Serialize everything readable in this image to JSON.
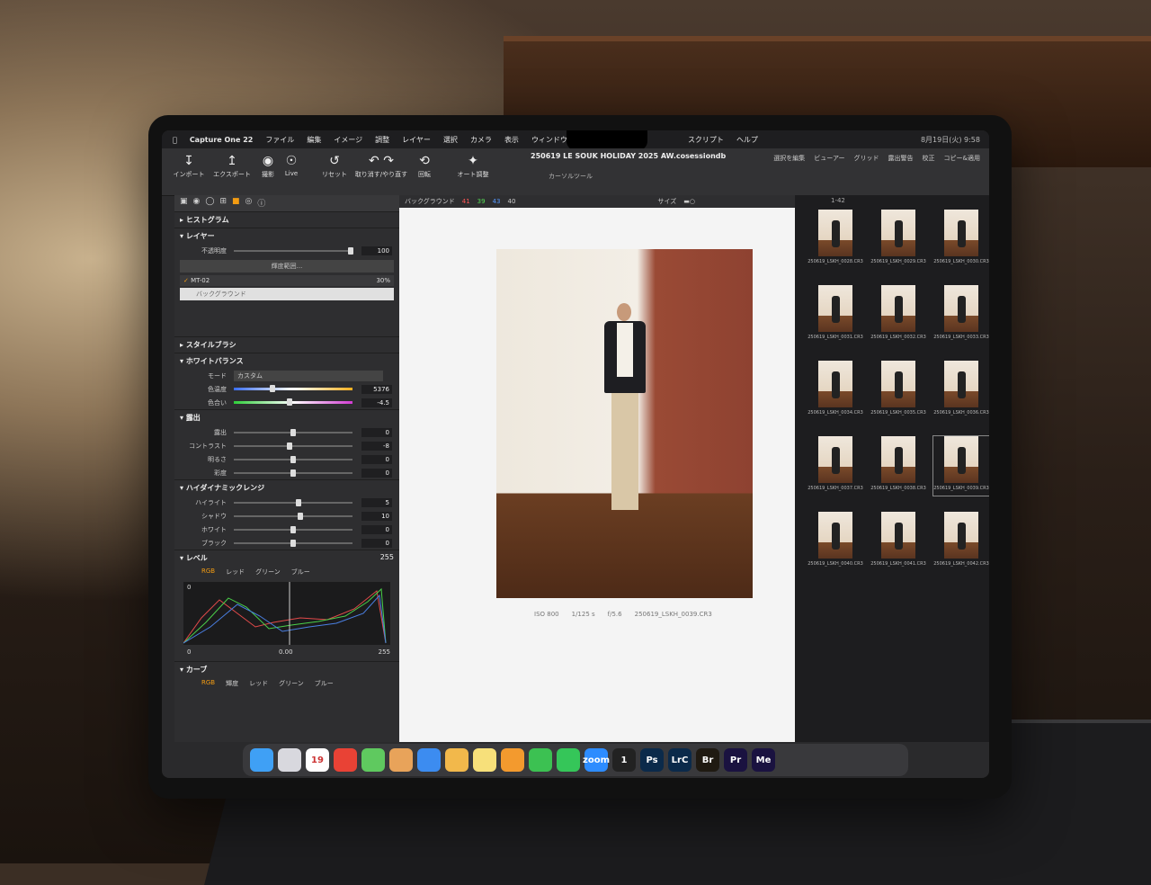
{
  "menubar": {
    "app_name": "Capture One 22",
    "items": [
      "ファイル",
      "編集",
      "イメージ",
      "調整",
      "レイヤー",
      "選択",
      "カメラ",
      "表示",
      "ウィンドウ",
      "スクリプト",
      "ヘルプ"
    ],
    "clock": "8月19日(火) 9:58"
  },
  "toolbar": {
    "import": "インポート",
    "export": "エクスポート",
    "capture": "撮影",
    "live": "Live",
    "reset": "リセット",
    "undo_redo": "取り消す/やり直す",
    "rotate": "回転",
    "auto_adjust": "オート調整",
    "cursor_tools": "カーソルツール",
    "doc_title": "250619 LE SOUK HOLIDAY 2025 AW.cosessiondb",
    "right_tools": [
      "選択を編集",
      "ビューアー",
      "グリッド",
      "露出警告",
      "校正",
      "コピー&適用"
    ]
  },
  "left_panel": {
    "histogram": "ヒストグラム",
    "layers": "レイヤー",
    "opacity_label": "不透明度",
    "opacity_value": "100",
    "luma_range": "輝度範囲...",
    "layer_name": "MT-02",
    "layer_opacity": "30%",
    "background_layer": "バックグラウンド",
    "style_brush": "スタイルブラシ",
    "white_balance": "ホワイトバランス",
    "mode_label": "モード",
    "mode_value": "カスタム",
    "temp_label": "色温度",
    "temp_value": "5376",
    "tint_label": "色合い",
    "tint_value": "-4.5",
    "exposure": "露出",
    "exposure_rows": [
      {
        "label": "露出",
        "value": "0"
      },
      {
        "label": "コントラスト",
        "value": "-8"
      },
      {
        "label": "明るさ",
        "value": "0"
      },
      {
        "label": "彩度",
        "value": "0"
      }
    ],
    "hdr": "ハイダイナミックレンジ",
    "hdr_rows": [
      {
        "label": "ハイライト",
        "value": "5"
      },
      {
        "label": "シャドウ",
        "value": "10"
      },
      {
        "label": "ホワイト",
        "value": "0"
      },
      {
        "label": "ブラック",
        "value": "0"
      }
    ],
    "levels": "レベル",
    "levels_tabs": [
      "RGB",
      "レッド",
      "グリーン",
      "ブルー"
    ],
    "levels_top": "255",
    "levels_left": "0",
    "levels_mid": "0.00",
    "levels_bottom_left": "0",
    "levels_bottom_right": "255",
    "curve": "カーブ",
    "curve_tabs": [
      "RGB",
      "輝度",
      "レッド",
      "グリーン",
      "ブルー"
    ]
  },
  "viewer": {
    "variant": "バックグラウンド",
    "rgb": {
      "r": "41",
      "g": "39",
      "b": "43",
      "a": "40"
    },
    "size_label": "サイズ",
    "iso": "ISO 800",
    "shutter": "1/125 s",
    "aperture": "f/5.6",
    "filename": "250619_LSKH_0039.CR3"
  },
  "browser": {
    "count": "1-42",
    "thumbs": [
      "250619_LSKH_0028.CR3",
      "250619_LSKH_0029.CR3",
      "250619_LSKH_0030.CR3",
      "250619_LSKH_0031.CR3",
      "250619_LSKH_0032.CR3",
      "250619_LSKH_0033.CR3",
      "250619_LSKH_0034.CR3",
      "250619_LSKH_0035.CR3",
      "250619_LSKH_0036.CR3",
      "250619_LSKH_0037.CR3",
      "250619_LSKH_0038.CR3",
      "250619_LSKH_0039.CR3",
      "250619_LSKH_0040.CR3",
      "250619_LSKH_0041.CR3",
      "250619_LSKH_0042.CR3"
    ]
  },
  "dock": [
    {
      "icon": "finder-icon",
      "label": "",
      "color": "#3fa0f5"
    },
    {
      "icon": "launchpad-icon",
      "label": "",
      "color": "#d8d8de"
    },
    {
      "icon": "calendar-icon",
      "label": "19",
      "color": "#ffffff"
    },
    {
      "icon": "chrome-icon",
      "label": "",
      "color": "#e94235"
    },
    {
      "icon": "maps-icon",
      "label": "",
      "color": "#5fc95f"
    },
    {
      "icon": "contacts-icon",
      "label": "",
      "color": "#e8a35a"
    },
    {
      "icon": "mail-icon",
      "label": "",
      "color": "#3c8cf0"
    },
    {
      "icon": "folder-icon",
      "label": "",
      "color": "#f2b84b"
    },
    {
      "icon": "notes-icon",
      "label": "",
      "color": "#f7e07a"
    },
    {
      "icon": "pages-icon",
      "label": "",
      "color": "#f39a2e"
    },
    {
      "icon": "numbers-icon",
      "label": "",
      "color": "#3cc152"
    },
    {
      "icon": "facetime-icon",
      "label": "",
      "color": "#35c659"
    },
    {
      "icon": "zoom-icon",
      "label": "zoom",
      "color": "#2d8cff"
    },
    {
      "icon": "capture-one-icon",
      "label": "1",
      "color": "#222222"
    },
    {
      "icon": "photoshop-icon",
      "label": "Ps",
      "color": "#0b2a4a"
    },
    {
      "icon": "lightroom-classic-icon",
      "label": "LrC",
      "color": "#0b2a4a"
    },
    {
      "icon": "bridge-icon",
      "label": "Br",
      "color": "#1f1a12"
    },
    {
      "icon": "premiere-icon",
      "label": "Pr",
      "color": "#1a1240"
    },
    {
      "icon": "media-encoder-icon",
      "label": "Me",
      "color": "#1a1240"
    }
  ]
}
